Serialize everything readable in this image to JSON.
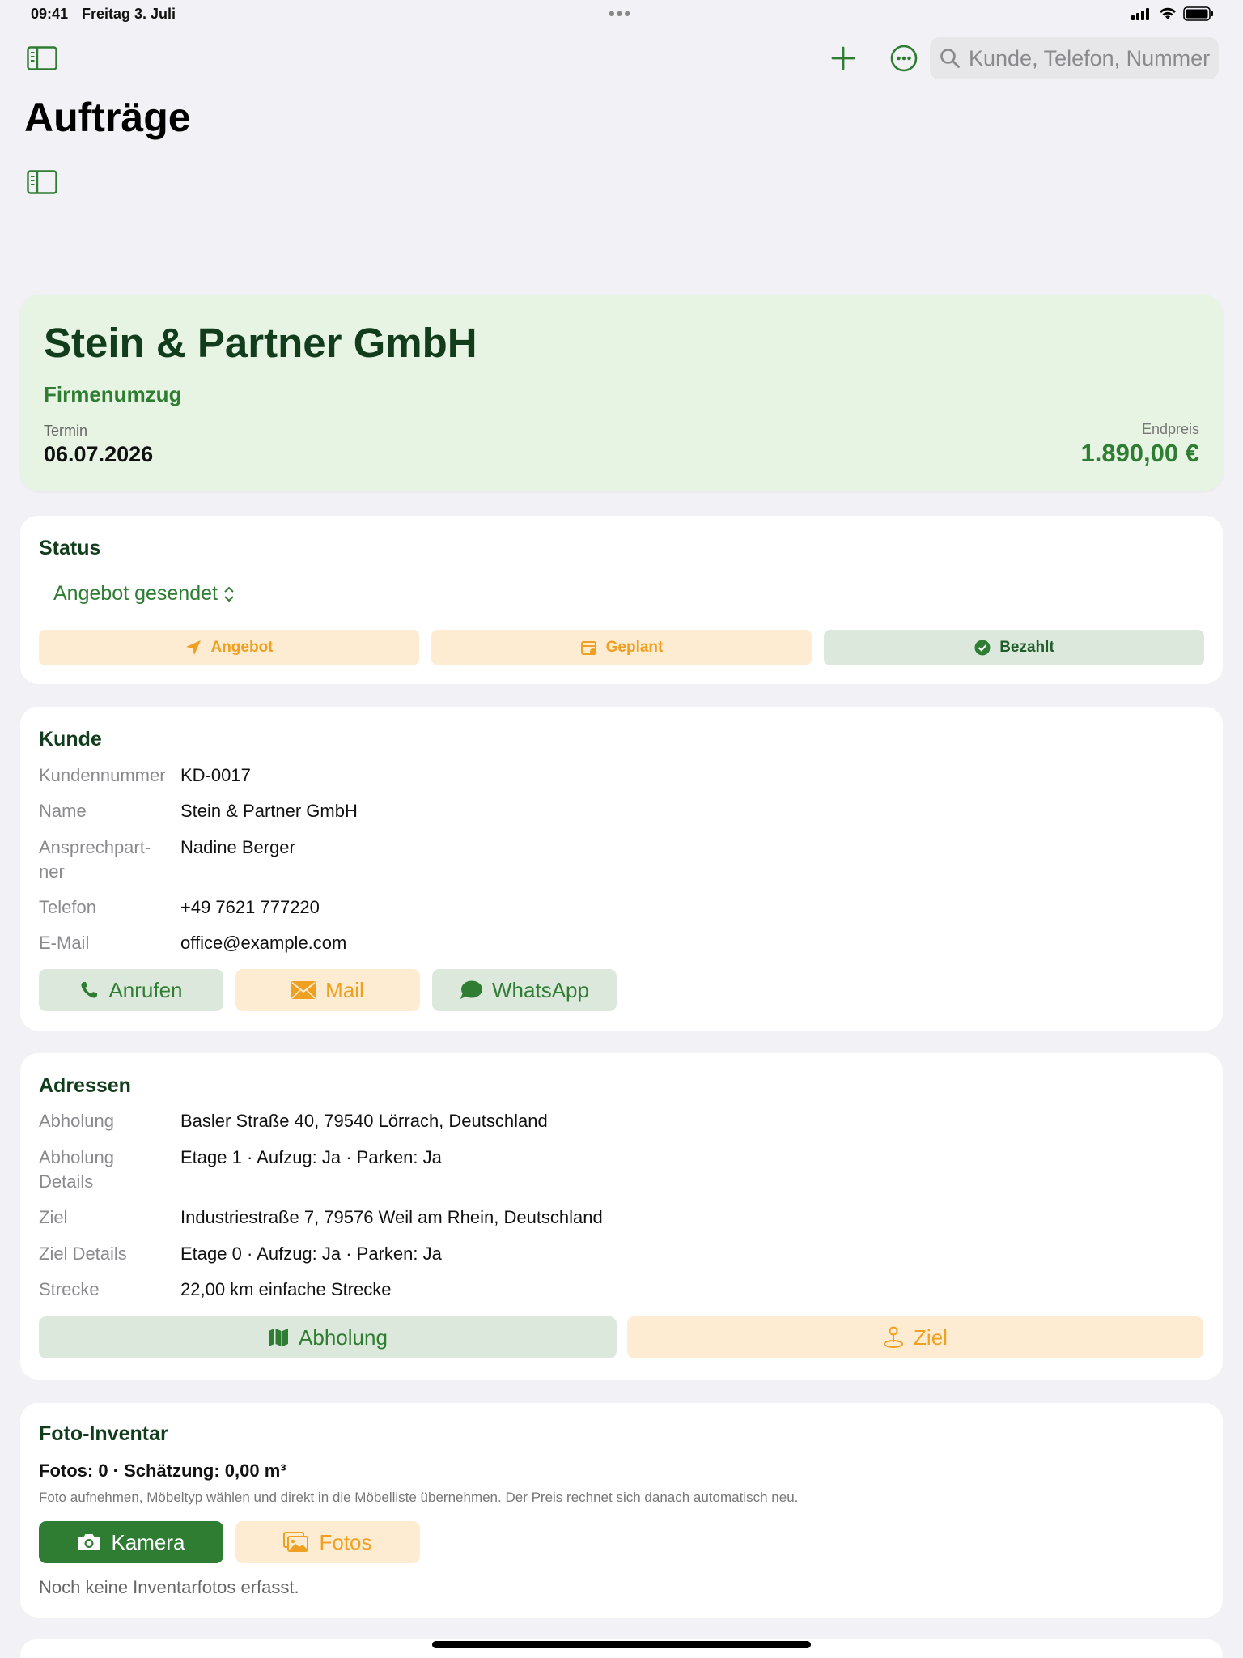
{
  "statusbar": {
    "time": "09:41",
    "date": "Freitag 3. Juli"
  },
  "toolbar": {
    "search_placeholder": "Kunde, Telefon, Nummer"
  },
  "page": {
    "title": "Aufträge"
  },
  "hero": {
    "company": "Stein & Partner GmbH",
    "type": "Firmenumzug",
    "termin_label": "Termin",
    "termin_value": "06.07.2026",
    "price_label": "Endpreis",
    "price_value": "1.890,00 €"
  },
  "status": {
    "title": "Status",
    "selected": "Angebot gesendet",
    "buttons": [
      "Angebot",
      "Geplant",
      "Bezahlt"
    ]
  },
  "kunde": {
    "title": "Kunde",
    "rows": [
      {
        "label": "Kundennummer",
        "value": "KD-0017"
      },
      {
        "label": "Name",
        "value": "Stein & Partner GmbH"
      },
      {
        "label": "Ansprechpart-\nner",
        "value": "Nadine Berger"
      },
      {
        "label": "Telefon",
        "value": "+49 7621 777220"
      },
      {
        "label": "E-Mail",
        "value": "office@example.com"
      }
    ],
    "actions": [
      "Anrufen",
      "Mail",
      "WhatsApp"
    ]
  },
  "adressen": {
    "title": "Adressen",
    "rows": [
      {
        "label": "Abholung",
        "value": "Basler Straße 40, 79540 Lörrach, Deutschland"
      },
      {
        "label": "Abholung\nDetails",
        "value": "Etage 1 · Aufzug: Ja · Parken: Ja"
      },
      {
        "label": "Ziel",
        "value": "Industriestraße 7, 79576 Weil am Rhein, Deutschland"
      },
      {
        "label": "Ziel Details",
        "value": "Etage 0 · Aufzug: Ja · Parken: Ja"
      },
      {
        "label": "Strecke",
        "value": "22,00 km einfache Strecke"
      }
    ],
    "actions": [
      "Abholung",
      "Ziel"
    ]
  },
  "inventar": {
    "title": "Foto-Inventar",
    "summary": "Fotos: 0 · Schätzung: 0,00 m³",
    "hint": "Foto aufnehmen, Möbeltyp wählen und direkt in die Möbelliste übernehmen. Der Preis rechnet sich danach automatisch neu.",
    "actions": [
      "Kamera",
      "Fotos"
    ],
    "empty": "Noch keine Inventarfotos erfasst."
  },
  "colors": {
    "accent": "#2e7d32",
    "orange": "#f0a020",
    "hero_bg": "#e7f4e3"
  },
  "icons": [
    "sidebar-icon",
    "plus-icon",
    "more-icon",
    "search-icon",
    "paperplane-icon",
    "calendar-icon",
    "checkmark-seal-icon",
    "phone-icon",
    "envelope-icon",
    "chat-bubble-icon",
    "map-icon",
    "pin-icon",
    "camera-icon",
    "photos-icon"
  ]
}
